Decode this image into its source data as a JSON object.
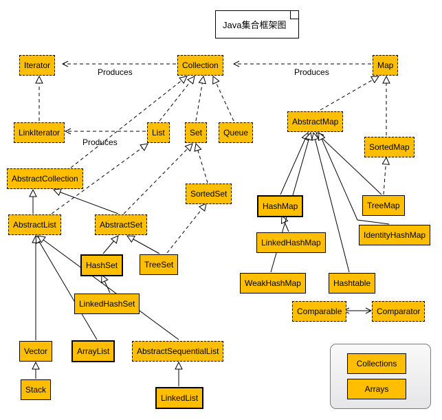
{
  "title": "Java集合框架图",
  "labels": {
    "produces1": "Produces",
    "produces2": "Produces",
    "produces3": "Produces"
  },
  "nodes": {
    "Iterator": "Iterator",
    "Collection": "Collection",
    "Map": "Map",
    "LinkIterator": "LinkIterator",
    "List": "List",
    "Set": "Set",
    "Queue": "Queue",
    "AbstractMap": "AbstractMap",
    "SortedMap": "SortedMap",
    "AbstractCollection": "AbstractCollection",
    "SortedSet": "SortedSet",
    "HashMap": "HashMap",
    "TreeMap": "TreeMap",
    "AbstractList": "AbstractList",
    "AbstractSet": "AbstractSet",
    "IdentityHashMap": "IdentityHashMap",
    "LinkedHashMap": "LinkedHashMap",
    "HashSet": "HashSet",
    "TreeSet": "TreeSet",
    "WeakHashMap": "WeakHashMap",
    "Hashtable": "Hashtable",
    "LinkedHashSet": "LinkedHashSet",
    "Comparable": "Comparable",
    "Comparator": "Comparator",
    "Vector": "Vector",
    "ArrayList": "ArrayList",
    "AbstractSequentialList": "AbstractSequentialList",
    "Stack": "Stack",
    "LinkedList": "LinkedList",
    "Collections": "Collections",
    "Arrays": "Arrays"
  },
  "chart_data": {
    "type": "uml-class-hierarchy",
    "title": "Java Collections Framework Diagram",
    "node_types": {
      "interface": [
        "Iterator",
        "Collection",
        "Map",
        "LinkIterator",
        "List",
        "Set",
        "Queue",
        "SortedMap",
        "SortedSet",
        "Comparable",
        "Comparator"
      ],
      "abstract_class": [
        "AbstractMap",
        "AbstractCollection",
        "AbstractList",
        "AbstractSet",
        "AbstractSequentialList"
      ],
      "concrete_class": [
        "HashMap",
        "TreeMap",
        "IdentityHashMap",
        "LinkedHashMap",
        "HashSet",
        "TreeSet",
        "WeakHashMap",
        "Hashtable",
        "LinkedHashSet",
        "Vector",
        "Stack",
        "LinkedList",
        "ArrayList",
        "Collections",
        "Arrays"
      ],
      "highlighted": [
        "HashMap",
        "HashSet",
        "ArrayList",
        "LinkedList"
      ]
    },
    "edges": [
      {
        "from": "Collection",
        "to": "Iterator",
        "type": "produces"
      },
      {
        "from": "Map",
        "to": "Collection",
        "type": "produces"
      },
      {
        "from": "List",
        "to": "LinkIterator",
        "type": "produces"
      },
      {
        "from": "LinkIterator",
        "to": "Iterator",
        "type": "extends-interface"
      },
      {
        "from": "List",
        "to": "Collection",
        "type": "extends-interface"
      },
      {
        "from": "Set",
        "to": "Collection",
        "type": "extends-interface"
      },
      {
        "from": "Queue",
        "to": "Collection",
        "type": "extends-interface"
      },
      {
        "from": "SortedSet",
        "to": "Set",
        "type": "extends-interface"
      },
      {
        "from": "SortedMap",
        "to": "Map",
        "type": "extends-interface"
      },
      {
        "from": "AbstractCollection",
        "to": "Collection",
        "type": "implements"
      },
      {
        "from": "AbstractMap",
        "to": "Map",
        "type": "implements"
      },
      {
        "from": "AbstractList",
        "to": "AbstractCollection",
        "type": "extends"
      },
      {
        "from": "AbstractList",
        "to": "List",
        "type": "implements"
      },
      {
        "from": "AbstractSet",
        "to": "AbstractCollection",
        "type": "extends"
      },
      {
        "from": "AbstractSet",
        "to": "Set",
        "type": "implements"
      },
      {
        "from": "HashSet",
        "to": "AbstractSet",
        "type": "extends"
      },
      {
        "from": "TreeSet",
        "to": "AbstractSet",
        "type": "extends"
      },
      {
        "from": "TreeSet",
        "to": "SortedSet",
        "type": "implements"
      },
      {
        "from": "LinkedHashSet",
        "to": "HashSet",
        "type": "extends"
      },
      {
        "from": "HashMap",
        "to": "AbstractMap",
        "type": "extends"
      },
      {
        "from": "LinkedHashMap",
        "to": "HashMap",
        "type": "extends"
      },
      {
        "from": "WeakHashMap",
        "to": "AbstractMap",
        "type": "extends"
      },
      {
        "from": "Hashtable",
        "to": "AbstractMap",
        "type": "extends"
      },
      {
        "from": "IdentityHashMap",
        "to": "AbstractMap",
        "type": "extends"
      },
      {
        "from": "TreeMap",
        "to": "AbstractMap",
        "type": "extends"
      },
      {
        "from": "TreeMap",
        "to": "SortedMap",
        "type": "implements"
      },
      {
        "from": "Vector",
        "to": "AbstractList",
        "type": "extends"
      },
      {
        "from": "ArrayList",
        "to": "AbstractList",
        "type": "extends"
      },
      {
        "from": "AbstractSequentialList",
        "to": "AbstractList",
        "type": "extends"
      },
      {
        "from": "Stack",
        "to": "Vector",
        "type": "extends"
      },
      {
        "from": "LinkedList",
        "to": "AbstractSequentialList",
        "type": "extends"
      },
      {
        "from": "Comparable",
        "to": "Comparator",
        "type": "bidirectional"
      }
    ],
    "legend_items": [
      "Collections",
      "Arrays"
    ]
  }
}
